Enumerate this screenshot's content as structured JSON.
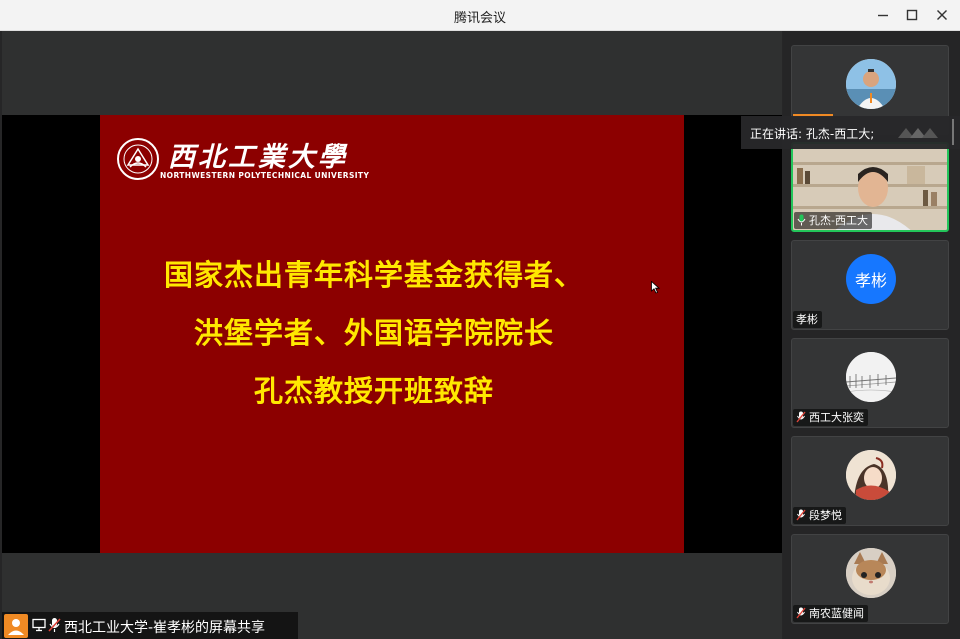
{
  "window": {
    "title": "腾讯会议",
    "minimize_glyph": "−",
    "maximize_glyph": "□",
    "close_glyph": "✕"
  },
  "slide": {
    "university_name_cn": "西北工業大學",
    "university_name_en": "NORTHWESTERN POLYTECHNICAL UNIVERSITY",
    "lines": [
      "国家杰出青年科学基金获得者、",
      "洪堡学者、外国语学院院长",
      "孔杰教授开班致辞"
    ],
    "background_color": "#8c0000",
    "text_color": "#ffe800"
  },
  "screen_share": {
    "label": "西北工业大学-崔孝彬的屏幕共享",
    "icons": [
      "user-icon",
      "screen-share-icon",
      "mic-muted-icon"
    ]
  },
  "speaker_banner": {
    "label": "正在讲话: 孔杰-西工大;"
  },
  "participants": [
    {
      "name": "",
      "avatar": "photo-man-outdoor",
      "mic": "unknown"
    },
    {
      "name": "孔杰-西工大",
      "avatar": "video-feed",
      "mic": "active",
      "speaking": true
    },
    {
      "name": "孝彬",
      "avatar": "initials",
      "avatar_text": "孝彬",
      "avatar_color": "#1677ff",
      "mic": "none"
    },
    {
      "name": "西工大张奕",
      "avatar": "sketch-photo",
      "mic": "muted"
    },
    {
      "name": "段梦悦",
      "avatar": "illustration",
      "mic": "muted"
    },
    {
      "name": "南农蓝健闻",
      "avatar": "cat-photo",
      "mic": "muted"
    }
  ],
  "colors": {
    "active_border": "#23c55a",
    "mic_active": "#23c55a",
    "mic_muted": "#e0443a",
    "share_avatar": "#f08a24"
  }
}
